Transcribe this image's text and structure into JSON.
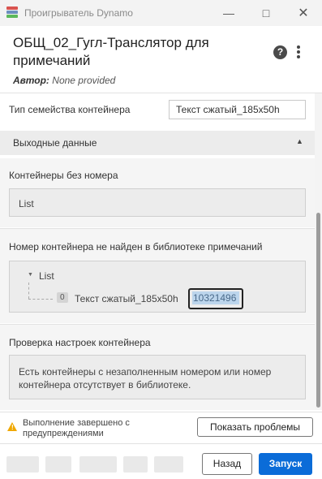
{
  "window": {
    "title": "Проигрыватель Dynamo",
    "minimize_icon": "minimize-icon",
    "maximize_icon": "maximize-icon",
    "close_icon": "close-icon"
  },
  "header": {
    "script_title": "ОБЩ_02_Гугл-Транслятор для примечаний",
    "author_label": "Автор:",
    "author_value": "None provided",
    "help_icon": "question-circle-icon",
    "more_icon": "more-vertical-icon"
  },
  "inputs": {
    "container_family_label": "Тип семейства контейнера",
    "container_family_value": "Текст сжатый_185x50h"
  },
  "outputs": {
    "section_label": "Выходные данные",
    "collapse_icon": "chevron-up-icon",
    "items": [
      {
        "label": "Контейнеры без номера",
        "value": "List"
      },
      {
        "label": "Номер контейнера не найден в библиотеке примечаний",
        "list_label": "List",
        "index": "0",
        "item_name": "Текст сжатый_185x50h",
        "item_number": "10321496"
      },
      {
        "label": "Проверка настроек контейнера",
        "message": "Есть контейнеры с незаполненным номером или номер контейнера отсутствует в библиотеке."
      }
    ]
  },
  "status": {
    "icon": "warning-icon",
    "warning_color": "#f0a800",
    "message": "Выполнение завершено с предупреждениями",
    "show_issues_button": "Показать проблемы"
  },
  "footer": {
    "back_button": "Назад",
    "run_button": "Запуск",
    "accent_color": "#0b6cd8"
  }
}
